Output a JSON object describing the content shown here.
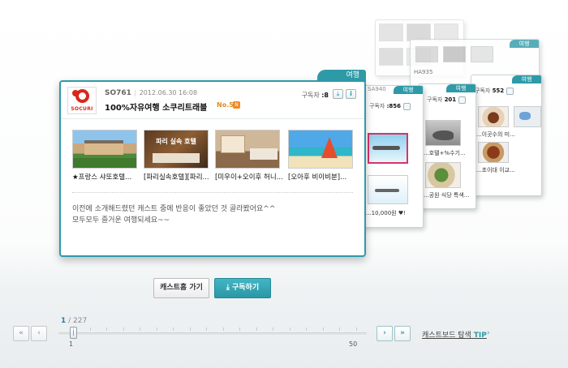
{
  "main_card": {
    "category": "여행",
    "id": "SO761",
    "date": "2012.06.30 16:08",
    "title": "100%자유여행 소쿠리트래블",
    "rank": "No.5",
    "subscribers_label": "구독자",
    "subscribers_value": ":8",
    "logo_text": "SOCURI",
    "rss_label": "N",
    "posts": [
      {
        "caption": "★프랑스 샤또호텔...",
        "overlay": ""
      },
      {
        "caption": "[파리실속호텔][파리...",
        "overlay": "파리 실속 호텔"
      },
      {
        "caption": "[미우이+오이후 허니...",
        "overlay": ""
      },
      {
        "caption": "[오아후 비이비분]...",
        "overlay": ""
      }
    ],
    "description_line1": "이전에 소개해드렸던 캐스트 중에 반응이 좋았던 것 골라봤어요^^",
    "description_line2": "모두모두 즐거운 여행되세요~~"
  },
  "back_cards": [
    {
      "category": "여행",
      "sub_label": "구독자",
      "sub_value": ":856",
      "code": "SA940",
      "captions": [
        "...10,000원 ♥!"
      ]
    },
    {
      "category": "여행",
      "sub_label": "구독자",
      "sub_value": "201",
      "captions": [
        "...호텔+%수기...",
        "...공원 식당 특색..."
      ]
    },
    {
      "category": "여행",
      "sub_label": "구독자",
      "sub_value": "552",
      "captions": [
        "...이곳수의 미...",
        "...초이대 이교..."
      ]
    },
    {
      "category": "여행",
      "code": "HA935",
      "captions": []
    }
  ],
  "buttons": {
    "home": "캐스트홈 가기",
    "subscribe": "구독하기",
    "subscribe_icon": "download-icon"
  },
  "pager": {
    "current": "1",
    "total": "/ 227",
    "min": "1",
    "max": "50",
    "first_label": "«",
    "prev_label": "‹",
    "next_label": "›",
    "last_label": "»",
    "position_fraction": 0.0
  },
  "tip": {
    "text": "캐스트보드 탐색",
    "tip_word": "TIP",
    "arrow": "›"
  },
  "colors": {
    "accent": "#2e9aa8",
    "brand_red": "#d9271c",
    "rank_orange": "#e08a1c"
  }
}
